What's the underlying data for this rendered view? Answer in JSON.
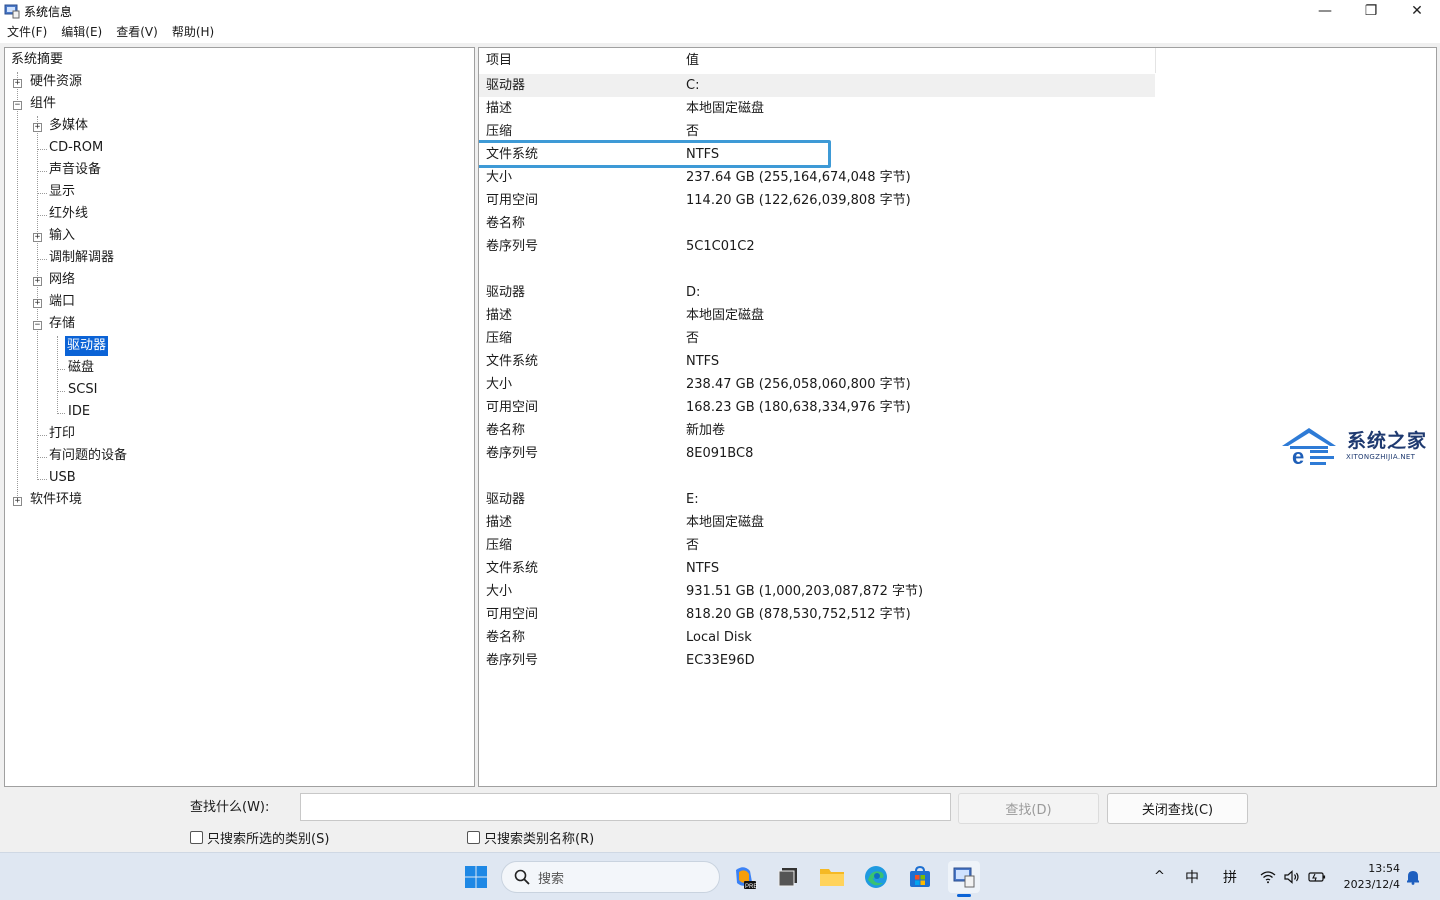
{
  "window": {
    "title": "系统信息",
    "minimize": "—",
    "maximize": "❐",
    "close": "✕"
  },
  "menu": [
    "文件(F)",
    "编辑(E)",
    "查看(V)",
    "帮助(H)"
  ],
  "tree": {
    "items": [
      {
        "label": "系统摘要"
      },
      {
        "label": "硬件资源"
      },
      {
        "label": "组件"
      },
      {
        "label": "多媒体"
      },
      {
        "label": "CD-ROM"
      },
      {
        "label": "声音设备"
      },
      {
        "label": "显示"
      },
      {
        "label": "红外线"
      },
      {
        "label": "输入"
      },
      {
        "label": "调制解调器"
      },
      {
        "label": "网络"
      },
      {
        "label": "端口"
      },
      {
        "label": "存储"
      },
      {
        "label": "驱动器"
      },
      {
        "label": "磁盘"
      },
      {
        "label": "SCSI"
      },
      {
        "label": "IDE"
      },
      {
        "label": "打印"
      },
      {
        "label": "有问题的设备"
      },
      {
        "label": "USB"
      },
      {
        "label": "软件环境"
      }
    ],
    "selected": "驱动器"
  },
  "detail": {
    "headers": [
      "项目",
      "值"
    ],
    "rows": [
      [
        "驱动器",
        "C:"
      ],
      [
        "描述",
        "本地固定磁盘"
      ],
      [
        "压缩",
        "否"
      ],
      [
        "文件系统",
        "NTFS"
      ],
      [
        "大小",
        "237.64 GB (255,164,674,048 字节)"
      ],
      [
        "可用空间",
        "114.20 GB (122,626,039,808 字节)"
      ],
      [
        "卷名称",
        ""
      ],
      [
        "卷序列号",
        "5C1C01C2"
      ],
      [
        "",
        ""
      ],
      [
        "驱动器",
        "D:"
      ],
      [
        "描述",
        "本地固定磁盘"
      ],
      [
        "压缩",
        "否"
      ],
      [
        "文件系统",
        "NTFS"
      ],
      [
        "大小",
        "238.47 GB (256,058,060,800 字节)"
      ],
      [
        "可用空间",
        "168.23 GB (180,638,334,976 字节)"
      ],
      [
        "卷名称",
        "新加卷"
      ],
      [
        "卷序列号",
        "8E091BC8"
      ],
      [
        "",
        ""
      ],
      [
        "驱动器",
        "E:"
      ],
      [
        "描述",
        "本地固定磁盘"
      ],
      [
        "压缩",
        "否"
      ],
      [
        "文件系统",
        "NTFS"
      ],
      [
        "大小",
        "931.51 GB (1,000,203,087,872 字节)"
      ],
      [
        "可用空间",
        "818.20 GB (878,530,752,512 字节)"
      ],
      [
        "卷名称",
        "Local Disk"
      ],
      [
        "卷序列号",
        "EC33E96D"
      ]
    ]
  },
  "watermark": {
    "title": "系统之家",
    "subtitle": "XITONGZHIJIA.NET"
  },
  "find": {
    "label": "查找什么(W):",
    "value": "",
    "find_button": "查找(D)",
    "close_button": "关闭查找(C)",
    "option_selected": "只搜索所选的类别(S)",
    "option_names": "只搜索类别名称(R)"
  },
  "taskbar": {
    "search_placeholder": "搜索",
    "ime_lang": "中",
    "ime_mode": "拼",
    "time": "13:54",
    "date": "2023/12/4",
    "chevron": "^"
  },
  "colors": {
    "selection": "#0b63d6",
    "highlight_box": "#3e9ad6",
    "taskbar": "#dfe7f2"
  }
}
